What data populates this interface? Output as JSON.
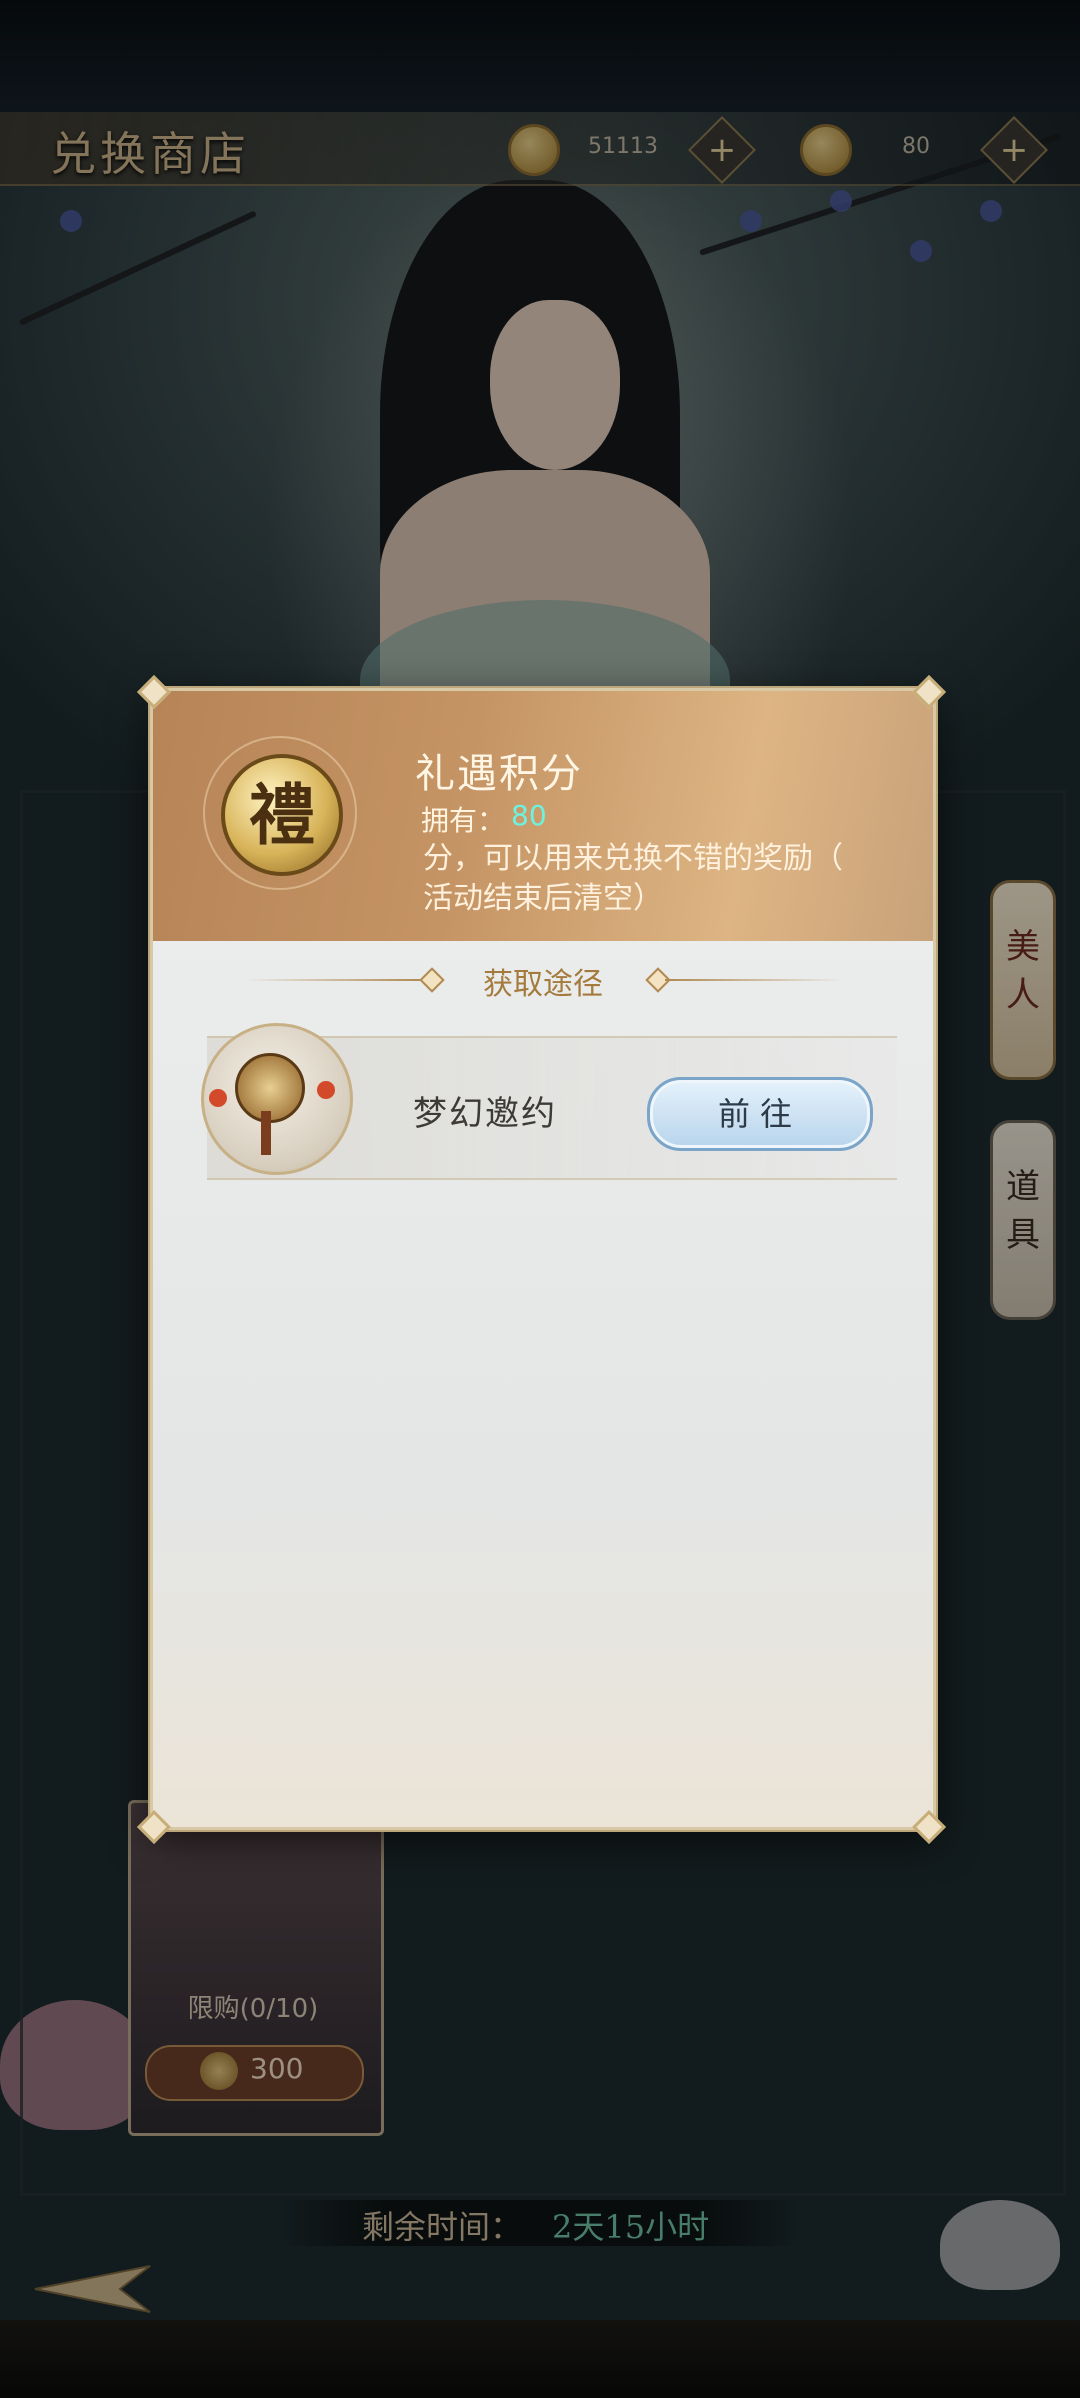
{
  "shop": {
    "title": "兑换商店",
    "currency_ingot": "51113",
    "currency_points": "80",
    "plus_symbol": "+"
  },
  "side_tabs": [
    {
      "label": "美人"
    },
    {
      "label": "道具"
    }
  ],
  "shop_item": {
    "limit": "限购(0/10)",
    "price": "300"
  },
  "timer": {
    "label": "剩余时间：",
    "value": "2天15小时"
  },
  "modal": {
    "badge_char": "禮",
    "item_name": "礼遇积分",
    "own_label": "拥有：",
    "own_value": "80",
    "description_line1": "分，可以用来兑换不错的奖励（",
    "description_line2": "活动结束后清空）",
    "section_title": "获取途径",
    "acquire": [
      {
        "name": "梦幻邀约",
        "button": "前往"
      }
    ]
  },
  "colors": {
    "accent_gold": "#b08950",
    "own_value": "#6ef2e0",
    "timer_value": "#6fc2a2",
    "button_blue": "#b7d4ec"
  }
}
